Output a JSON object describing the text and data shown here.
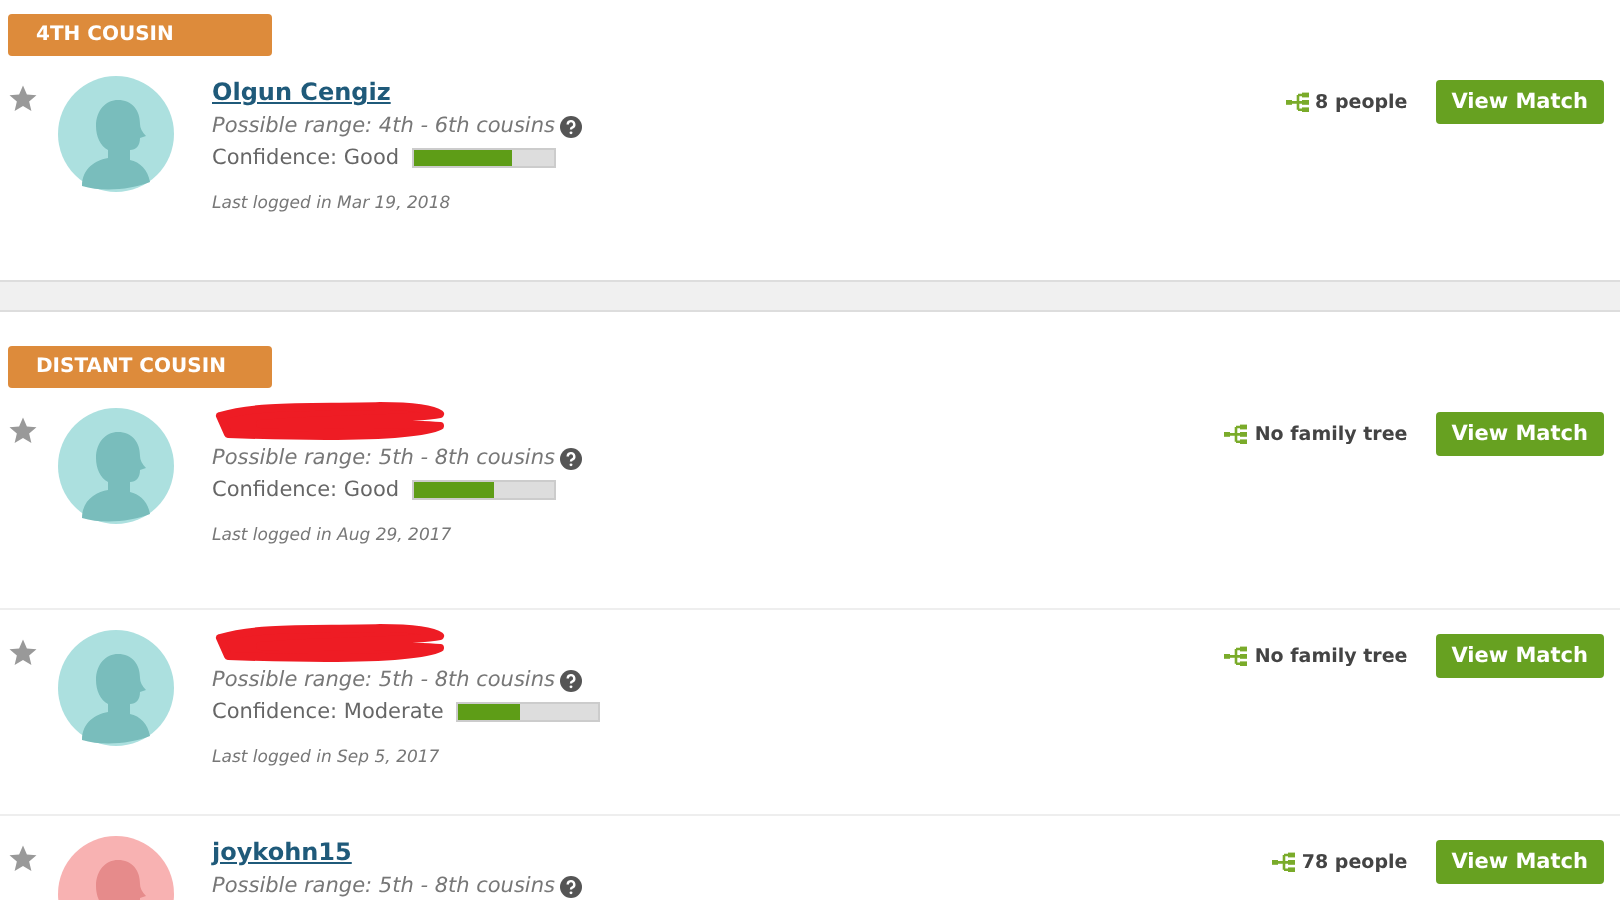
{
  "sections": [
    {
      "label": "4TH COUSIN",
      "matches": [
        {
          "color": "#ace0df",
          "name": "Olgun Cengiz",
          "redacted": false,
          "range": "Possible range: 4th - 6th cousins",
          "confidence": "Confidence: Good",
          "level": 0.7,
          "last_logged": "Last logged in Mar 19, 2018",
          "tree": "8 people",
          "button": "View Match"
        }
      ]
    },
    {
      "label": "DISTANT COUSIN",
      "matches": [
        {
          "color": "#ace0df",
          "redacted": true,
          "range": "Possible range: 5th - 8th cousins",
          "confidence": "Confidence: Good",
          "level": 0.58,
          "last_logged": "Last logged in Aug 29, 2017",
          "tree": "No family tree",
          "button": "View Match"
        },
        {
          "color": "#ace0df",
          "redacted": true,
          "range": "Possible range: 5th - 8th cousins",
          "confidence": "Confidence: Moderate",
          "level": 0.45,
          "last_logged": "Last logged in Sep 5, 2017",
          "tree": "No family tree",
          "button": "View Match"
        },
        {
          "color": "#f8b2b2",
          "name": "joykohn15",
          "redacted": false,
          "range": "Possible range: 5th - 8th cousins",
          "tree": "78 people",
          "button": "View Match"
        }
      ]
    }
  ]
}
